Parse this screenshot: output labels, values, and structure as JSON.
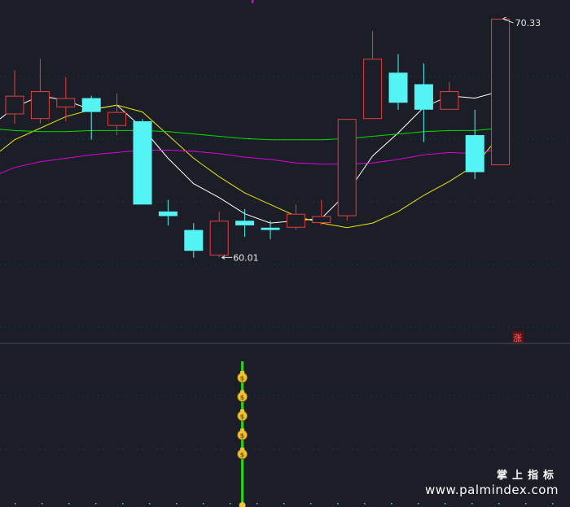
{
  "chart_data": {
    "type": "candlestick",
    "price_ylim": [
      57.0,
      71.0
    ],
    "candles": [
      {
        "open": 66.2,
        "close": 67.0,
        "high": 68.1,
        "low": 65.8,
        "dir": "up"
      },
      {
        "open": 66.0,
        "close": 67.2,
        "high": 68.6,
        "low": 65.8,
        "dir": "up"
      },
      {
        "open": 66.5,
        "close": 66.9,
        "high": 67.8,
        "low": 65.9,
        "dir": "up"
      },
      {
        "open": 66.9,
        "close": 66.3,
        "high": 67.0,
        "low": 65.1,
        "dir": "down"
      },
      {
        "open": 65.7,
        "close": 66.3,
        "high": 67.1,
        "low": 65.3,
        "dir": "up"
      },
      {
        "open": 65.9,
        "close": 62.3,
        "high": 66.0,
        "low": 62.3,
        "dir": "down"
      },
      {
        "open": 62.0,
        "close": 61.8,
        "high": 62.5,
        "low": 61.4,
        "dir": "down"
      },
      {
        "open": 61.2,
        "close": 60.3,
        "high": 61.5,
        "low": 60.0,
        "dir": "down"
      },
      {
        "open": 60.1,
        "close": 61.6,
        "high": 62.0,
        "low": 60.01,
        "dir": "up"
      },
      {
        "open": 61.6,
        "close": 61.4,
        "high": 62.1,
        "low": 60.9,
        "dir": "down"
      },
      {
        "open": 61.3,
        "close": 61.2,
        "high": 61.6,
        "low": 60.8,
        "dir": "down"
      },
      {
        "open": 61.3,
        "close": 61.9,
        "high": 62.3,
        "low": 61.2,
        "dir": "up"
      },
      {
        "open": 61.5,
        "close": 61.8,
        "high": 62.5,
        "low": 61.4,
        "dir": "up"
      },
      {
        "open": 61.8,
        "close": 66.0,
        "high": 66.0,
        "low": 61.6,
        "dir": "up"
      },
      {
        "open": 66.0,
        "close": 68.6,
        "high": 69.8,
        "low": 66.0,
        "dir": "up"
      },
      {
        "open": 68.0,
        "close": 66.7,
        "high": 68.8,
        "low": 66.4,
        "dir": "down"
      },
      {
        "open": 67.5,
        "close": 66.4,
        "high": 68.4,
        "low": 65.0,
        "dir": "down"
      },
      {
        "open": 66.4,
        "close": 67.2,
        "high": 67.6,
        "low": 66.4,
        "dir": "up"
      },
      {
        "open": 65.3,
        "close": 63.7,
        "high": 66.4,
        "low": 63.4,
        "dir": "down"
      },
      {
        "open": 64.0,
        "close": 70.33,
        "high": 70.33,
        "low": 64.0,
        "dir": "up"
      }
    ],
    "ma_lines": [
      {
        "color": "#ffffff",
        "values": [
          66.5,
          67.0,
          66.8,
          66.4,
          66.6,
          65.6,
          64.3,
          63.2,
          62.6,
          61.9,
          61.5,
          61.6,
          61.7,
          62.8,
          64.4,
          65.4,
          66.5,
          67.0,
          66.9,
          67.2
        ]
      },
      {
        "color": "#e6e600",
        "values": [
          65.1,
          65.6,
          66.1,
          66.4,
          66.6,
          66.3,
          65.3,
          64.3,
          63.5,
          62.8,
          62.3,
          61.8,
          61.5,
          61.3,
          61.5,
          62.0,
          62.7,
          63.3,
          64.0,
          65.3
        ]
      },
      {
        "color": "#00dd00",
        "values": [
          65.5,
          65.45,
          65.45,
          65.5,
          65.5,
          65.5,
          65.45,
          65.35,
          65.25,
          65.15,
          65.1,
          65.1,
          65.1,
          65.15,
          65.25,
          65.35,
          65.45,
          65.5,
          65.5,
          65.6
        ]
      },
      {
        "color": "#e000e0",
        "values": [
          63.9,
          64.15,
          64.3,
          64.45,
          64.55,
          64.65,
          64.65,
          64.6,
          64.5,
          64.35,
          64.25,
          64.1,
          64.05,
          64.05,
          64.1,
          64.25,
          64.45,
          64.55,
          64.5,
          64.7
        ]
      }
    ],
    "annotations": {
      "low": "60.01",
      "high": "70.33"
    },
    "rise_marker": "涨",
    "signal_candle_index": 9,
    "signal_icon_count": 5
  },
  "branding": {
    "cn": "掌上指标",
    "url": "www.palmindex.com"
  },
  "colors": {
    "background": "#1b1e26",
    "up": "#e0403f",
    "down": "#55f4f4",
    "grid": "#3a3f4a",
    "signal": "#29d61c",
    "coin": "#f1c232"
  }
}
